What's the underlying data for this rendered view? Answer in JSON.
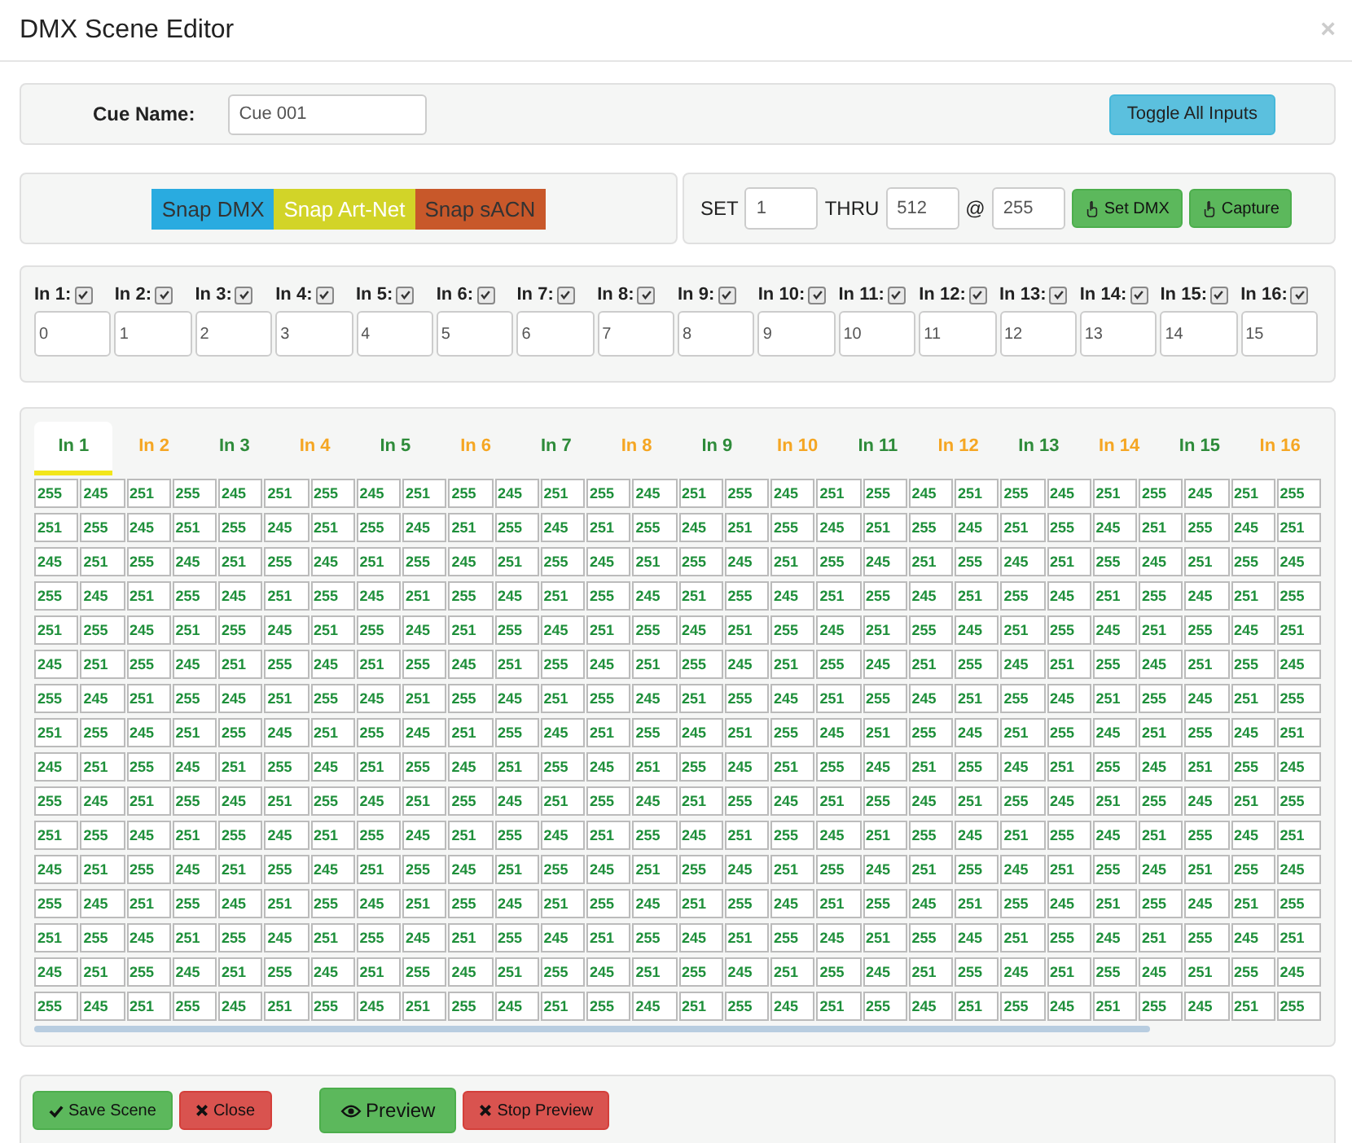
{
  "window": {
    "title": "DMX Scene Editor",
    "close": "×"
  },
  "cue": {
    "label": "Cue Name:",
    "value": "Cue 001",
    "toggle_button": "Toggle All Inputs"
  },
  "snap_buttons": [
    {
      "label": "Snap DMX",
      "color": "#29abe0",
      "kind": "dark"
    },
    {
      "label": "Snap Art-Net",
      "color": "#d2d428",
      "kind": "light"
    },
    {
      "label": "Snap sACN",
      "color": "#c8582a",
      "kind": "dark"
    }
  ],
  "set": {
    "set_label": "SET",
    "start": "1",
    "thru_label": "THRU",
    "end": "512",
    "at_label": "@",
    "value": "255",
    "buttons": [
      "Set DMX",
      "Capture"
    ]
  },
  "inputs": [
    {
      "label": "In 1:",
      "checked": true,
      "value": "0"
    },
    {
      "label": "In 2:",
      "checked": true,
      "value": "1"
    },
    {
      "label": "In 3:",
      "checked": true,
      "value": "2"
    },
    {
      "label": "In 4:",
      "checked": true,
      "value": "3"
    },
    {
      "label": "In 5:",
      "checked": true,
      "value": "4"
    },
    {
      "label": "In 6:",
      "checked": true,
      "value": "5"
    },
    {
      "label": "In 7:",
      "checked": true,
      "value": "6"
    },
    {
      "label": "In 8:",
      "checked": true,
      "value": "7"
    },
    {
      "label": "In 9:",
      "checked": true,
      "value": "8"
    },
    {
      "label": "In 10:",
      "checked": true,
      "value": "9"
    },
    {
      "label": "In 11:",
      "checked": true,
      "value": "10"
    },
    {
      "label": "In 12:",
      "checked": true,
      "value": "11"
    },
    {
      "label": "In 13:",
      "checked": true,
      "value": "12"
    },
    {
      "label": "In 14:",
      "checked": true,
      "value": "13"
    },
    {
      "label": "In 15:",
      "checked": true,
      "value": "14"
    },
    {
      "label": "In 16:",
      "checked": true,
      "value": "15"
    }
  ],
  "tabs": [
    {
      "label": "In 1",
      "selected": true,
      "color": "#2e8b3a"
    },
    {
      "label": "In 2",
      "selected": false,
      "color": "#f5a623"
    },
    {
      "label": "In 3",
      "selected": false,
      "color": "#2e8b3a"
    },
    {
      "label": "In 4",
      "selected": false,
      "color": "#f5a623"
    },
    {
      "label": "In 5",
      "selected": false,
      "color": "#2e8b3a"
    },
    {
      "label": "In 6",
      "selected": false,
      "color": "#f5a623"
    },
    {
      "label": "In 7",
      "selected": false,
      "color": "#2e8b3a"
    },
    {
      "label": "In 8",
      "selected": false,
      "color": "#f5a623"
    },
    {
      "label": "In 9",
      "selected": false,
      "color": "#2e8b3a"
    },
    {
      "label": "In 10",
      "selected": false,
      "color": "#f5a623"
    },
    {
      "label": "In 11",
      "selected": false,
      "color": "#2e8b3a"
    },
    {
      "label": "In 12",
      "selected": false,
      "color": "#f5a623"
    },
    {
      "label": "In 13",
      "selected": false,
      "color": "#2e8b3a"
    },
    {
      "label": "In 14",
      "selected": false,
      "color": "#f5a623"
    },
    {
      "label": "In 15",
      "selected": false,
      "color": "#2e8b3a"
    },
    {
      "label": "In 16",
      "selected": false,
      "color": "#f5a623"
    }
  ],
  "channel_grid": [
    [
      "255",
      "245",
      "251",
      "255",
      "245",
      "251",
      "255",
      "245",
      "251",
      "255",
      "245",
      "251",
      "255",
      "245",
      "251",
      "255",
      "245",
      "251",
      "255",
      "245",
      "251",
      "255",
      "245",
      "251",
      "255",
      "245",
      "251",
      "255"
    ],
    [
      "251",
      "255",
      "245",
      "251",
      "255",
      "245",
      "251",
      "255",
      "245",
      "251",
      "255",
      "245",
      "251",
      "255",
      "245",
      "251",
      "255",
      "245",
      "251",
      "255",
      "245",
      "251",
      "255",
      "245",
      "251",
      "255",
      "245",
      "251"
    ],
    [
      "245",
      "251",
      "255",
      "245",
      "251",
      "255",
      "245",
      "251",
      "255",
      "245",
      "251",
      "255",
      "245",
      "251",
      "255",
      "245",
      "251",
      "255",
      "245",
      "251",
      "255",
      "245",
      "251",
      "255",
      "245",
      "251",
      "255",
      "245"
    ],
    [
      "255",
      "245",
      "251",
      "255",
      "245",
      "251",
      "255",
      "245",
      "251",
      "255",
      "245",
      "251",
      "255",
      "245",
      "251",
      "255",
      "245",
      "251",
      "255",
      "245",
      "251",
      "255",
      "245",
      "251",
      "255",
      "245",
      "251",
      "255"
    ],
    [
      "251",
      "255",
      "245",
      "251",
      "255",
      "245",
      "251",
      "255",
      "245",
      "251",
      "255",
      "245",
      "251",
      "255",
      "245",
      "251",
      "255",
      "245",
      "251",
      "255",
      "245",
      "251",
      "255",
      "245",
      "251",
      "255",
      "245",
      "251"
    ],
    [
      "245",
      "251",
      "255",
      "245",
      "251",
      "255",
      "245",
      "251",
      "255",
      "245",
      "251",
      "255",
      "245",
      "251",
      "255",
      "245",
      "251",
      "255",
      "245",
      "251",
      "255",
      "245",
      "251",
      "255",
      "245",
      "251",
      "255",
      "245"
    ],
    [
      "255",
      "245",
      "251",
      "255",
      "245",
      "251",
      "255",
      "245",
      "251",
      "255",
      "245",
      "251",
      "255",
      "245",
      "251",
      "255",
      "245",
      "251",
      "255",
      "245",
      "251",
      "255",
      "245",
      "251",
      "255",
      "245",
      "251",
      "255"
    ],
    [
      "251",
      "255",
      "245",
      "251",
      "255",
      "245",
      "251",
      "255",
      "245",
      "251",
      "255",
      "245",
      "251",
      "255",
      "245",
      "251",
      "255",
      "245",
      "251",
      "255",
      "245",
      "251",
      "255",
      "245",
      "251",
      "255",
      "245",
      "251"
    ],
    [
      "245",
      "251",
      "255",
      "245",
      "251",
      "255",
      "245",
      "251",
      "255",
      "245",
      "251",
      "255",
      "245",
      "251",
      "255",
      "245",
      "251",
      "255",
      "245",
      "251",
      "255",
      "245",
      "251",
      "255",
      "245",
      "251",
      "255",
      "245"
    ],
    [
      "255",
      "245",
      "251",
      "255",
      "245",
      "251",
      "255",
      "245",
      "251",
      "255",
      "245",
      "251",
      "255",
      "245",
      "251",
      "255",
      "245",
      "251",
      "255",
      "245",
      "251",
      "255",
      "245",
      "251",
      "255",
      "245",
      "251",
      "255"
    ],
    [
      "251",
      "255",
      "245",
      "251",
      "255",
      "245",
      "251",
      "255",
      "245",
      "251",
      "255",
      "245",
      "251",
      "255",
      "245",
      "251",
      "255",
      "245",
      "251",
      "255",
      "245",
      "251",
      "255",
      "245",
      "251",
      "255",
      "245",
      "251"
    ],
    [
      "245",
      "251",
      "255",
      "245",
      "251",
      "255",
      "245",
      "251",
      "255",
      "245",
      "251",
      "255",
      "245",
      "251",
      "255",
      "245",
      "251",
      "255",
      "245",
      "251",
      "255",
      "245",
      "251",
      "255",
      "245",
      "251",
      "255",
      "245"
    ],
    [
      "255",
      "245",
      "251",
      "255",
      "245",
      "251",
      "255",
      "245",
      "251",
      "255",
      "245",
      "251",
      "255",
      "245",
      "251",
      "255",
      "245",
      "251",
      "255",
      "245",
      "251",
      "255",
      "245",
      "251",
      "255",
      "245",
      "251",
      "255"
    ],
    [
      "251",
      "255",
      "245",
      "251",
      "255",
      "245",
      "251",
      "255",
      "245",
      "251",
      "255",
      "245",
      "251",
      "255",
      "245",
      "251",
      "255",
      "245",
      "251",
      "255",
      "245",
      "251",
      "255",
      "245",
      "251",
      "255",
      "245",
      "251"
    ],
    [
      "245",
      "251",
      "255",
      "245",
      "251",
      "255",
      "245",
      "251",
      "255",
      "245",
      "251",
      "255",
      "245",
      "251",
      "255",
      "245",
      "251",
      "255",
      "245",
      "251",
      "255",
      "245",
      "251",
      "255",
      "245",
      "251",
      "255",
      "245"
    ],
    [
      "255",
      "245",
      "251",
      "255",
      "245",
      "251",
      "255",
      "245",
      "251",
      "255",
      "245",
      "251",
      "255",
      "245",
      "251",
      "255",
      "245",
      "251",
      "255",
      "245",
      "251",
      "255",
      "245",
      "251",
      "255",
      "245",
      "251",
      "255"
    ]
  ],
  "footer_buttons": [
    {
      "label": "Save Scene",
      "kind": "save"
    },
    {
      "label": "Close",
      "kind": "close"
    },
    {
      "label": "Preview",
      "kind": "preview"
    },
    {
      "label": "Stop Preview",
      "kind": "stop"
    }
  ]
}
